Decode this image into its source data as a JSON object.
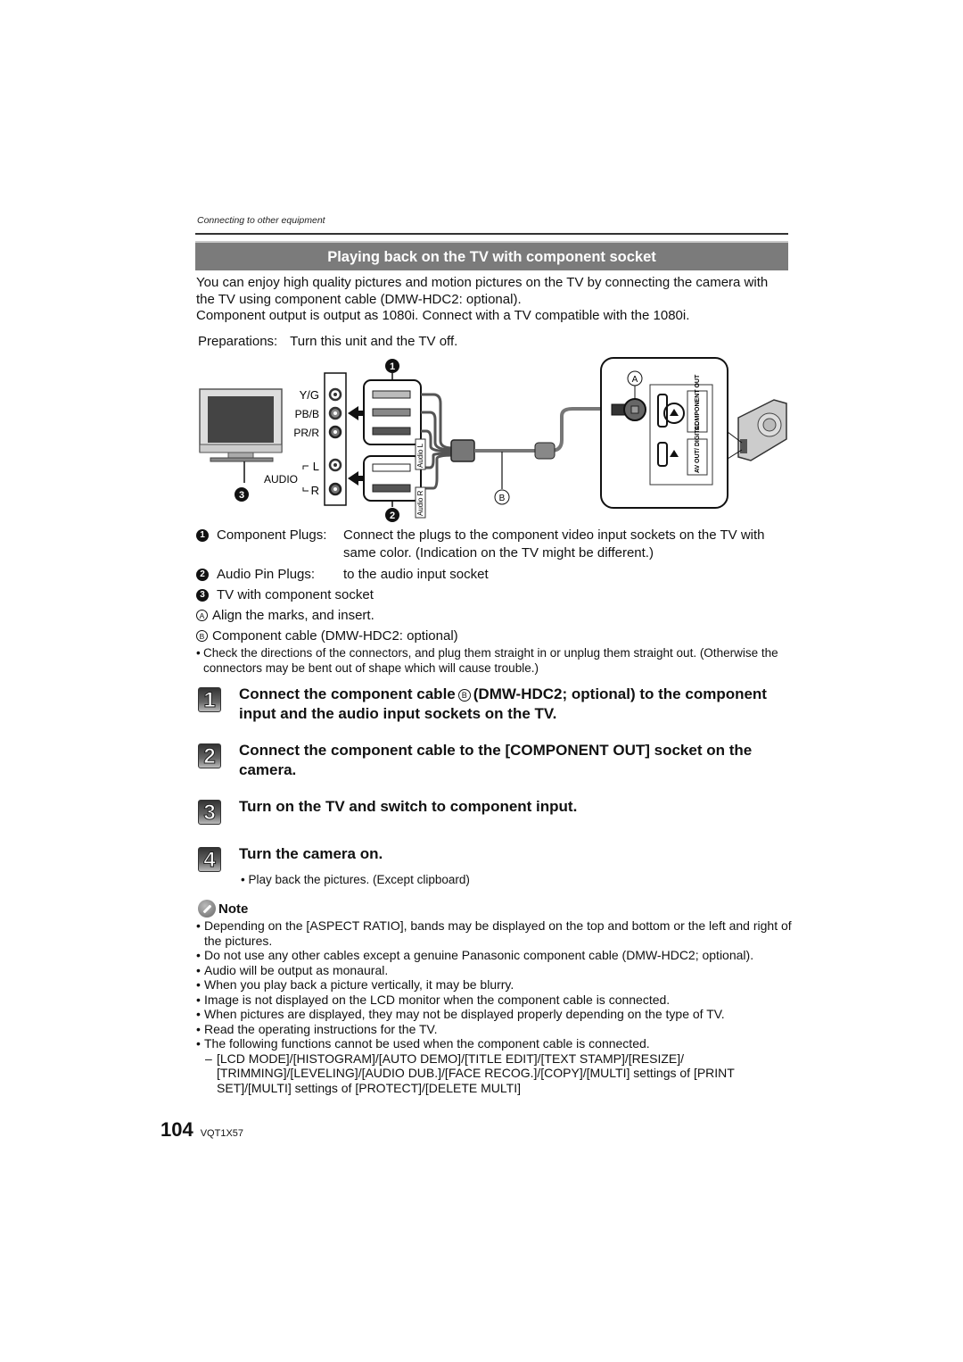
{
  "header": {
    "breadcrumb": "Connecting to other equipment",
    "section_title": "Playing back on the TV with component socket"
  },
  "intro": {
    "line1": "You can enjoy high quality pictures and motion pictures on the TV by connecting the camera with the TV using component cable (DMW-HDC2: optional).",
    "line2": "Component output is output as 1080i. Connect with a TV compatible with the 1080i.",
    "preparations_label": "Preparations:",
    "preparations_text": "Turn this unit and the TV off."
  },
  "diagram": {
    "tv_sockets": [
      "Y/G",
      "PB/B",
      "PR/R"
    ],
    "audio_label": "AUDIO",
    "audio_channels": [
      "L",
      "R"
    ],
    "cable_tags": [
      "Audio L",
      "Audio R"
    ],
    "markers": [
      "1",
      "2",
      "3"
    ],
    "letter_markers": [
      "A",
      "B"
    ],
    "camera_ports": [
      "COMPONENT OUT",
      "AV OUT/ DIGITAL"
    ]
  },
  "legend": [
    {
      "marker": "1",
      "term": "Component Plugs:",
      "text": "Connect the plugs to the component video input sockets on the TV with same color. (Indication on the TV might be different.)"
    },
    {
      "marker": "2",
      "term": "Audio Pin Plugs:",
      "text": "to the audio input socket"
    },
    {
      "marker": "3",
      "term": "",
      "text": "TV with component socket"
    }
  ],
  "letter_legend": [
    {
      "marker": "A",
      "text": "Align the marks, and insert."
    },
    {
      "marker": "B",
      "text": "Component cable (DMW-HDC2: optional)"
    }
  ],
  "caution": "Check the directions of the connectors, and plug them straight in or unplug them straight out. (Otherwise the connectors may be bent out of shape which will cause trouble.)",
  "steps": [
    {
      "number": "1",
      "text_before": "Connect the component cable",
      "marker": "B",
      "text_after": "(DMW-HDC2; optional) to the component input and the audio input sockets on the TV."
    },
    {
      "number": "2",
      "text": "Connect the component cable to the [COMPONENT OUT] socket on the camera."
    },
    {
      "number": "3",
      "text": "Turn on the TV and switch to component input."
    },
    {
      "number": "4",
      "text": "Turn the camera on."
    }
  ],
  "step4_sub": "Play back the pictures. (Except clipboard)",
  "note": {
    "title": "Note",
    "items": [
      "Depending on the [ASPECT RATIO], bands may be displayed on the top and bottom or the left and right of the pictures.",
      "Do not use any other cables except a genuine Panasonic component cable (DMW-HDC2; optional).",
      "Audio will be output as monaural.",
      "When you play back a picture vertically, it may be blurry.",
      "Image is not displayed on the LCD monitor when the component cable is connected.",
      "When pictures are displayed, they may not be displayed properly depending on the type of TV.",
      "Read the operating instructions for the TV.",
      "The following functions cannot be used when the component cable is connected."
    ],
    "sub_item": "[LCD MODE]/[HISTOGRAM]/[AUTO DEMO]/[TITLE EDIT]/[TEXT STAMP]/[RESIZE]/ [TRIMMING]/[LEVELING]/[AUDIO DUB.]/[FACE RECOG.]/[COPY]/[MULTI] settings of [PRINT SET]/[MULTI] settings of [PROTECT]/[DELETE MULTI]"
  },
  "footer": {
    "page_number": "104",
    "doc_code": "VQT1X57"
  }
}
